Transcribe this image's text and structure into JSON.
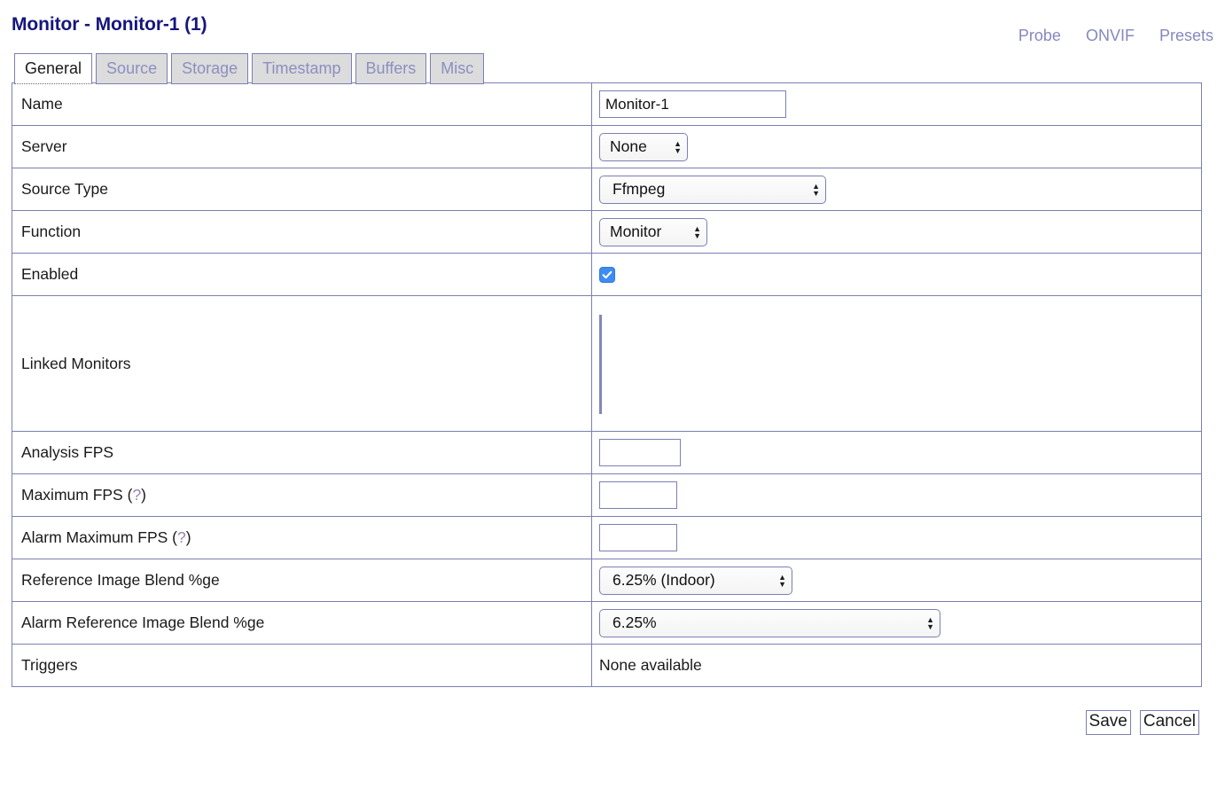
{
  "header": {
    "title": "Monitor - Monitor-1 (1)",
    "links": [
      {
        "label": "Probe"
      },
      {
        "label": "ONVIF"
      },
      {
        "label": "Presets"
      }
    ]
  },
  "tabs": [
    {
      "label": "General",
      "active": true
    },
    {
      "label": "Source",
      "active": false
    },
    {
      "label": "Storage",
      "active": false
    },
    {
      "label": "Timestamp",
      "active": false
    },
    {
      "label": "Buffers",
      "active": false
    },
    {
      "label": "Misc",
      "active": false
    }
  ],
  "form": {
    "name": {
      "label": "Name",
      "value": "Monitor-1"
    },
    "server": {
      "label": "Server",
      "value": "None"
    },
    "source_type": {
      "label": "Source Type",
      "value": "Ffmpeg"
    },
    "function": {
      "label": "Function",
      "value": "Monitor"
    },
    "enabled": {
      "label": "Enabled",
      "checked": true
    },
    "linked_monitors": {
      "label": "Linked Monitors",
      "value": ""
    },
    "analysis_fps": {
      "label": "Analysis FPS",
      "value": ""
    },
    "maximum_fps": {
      "label": "Maximum FPS",
      "help_open": "(",
      "help_q": "?",
      "help_close": ")",
      "value": ""
    },
    "alarm_maximum_fps": {
      "label": "Alarm Maximum FPS",
      "help_open": "(",
      "help_q": "?",
      "help_close": ")",
      "value": ""
    },
    "reference_blend": {
      "label": "Reference Image Blend %ge",
      "value": "6.25% (Indoor)"
    },
    "alarm_reference_blend": {
      "label": "Alarm Reference Image Blend %ge",
      "value": "6.25%"
    },
    "triggers": {
      "label": "Triggers",
      "value": "None available"
    }
  },
  "buttons": {
    "save": "Save",
    "cancel": "Cancel"
  },
  "colors": {
    "title": "#16167e",
    "border": "#7b7fb4",
    "link": "#8589bd",
    "checkbox": "#3d8cf5",
    "tab_inactive_text": "#8b8fc2"
  }
}
